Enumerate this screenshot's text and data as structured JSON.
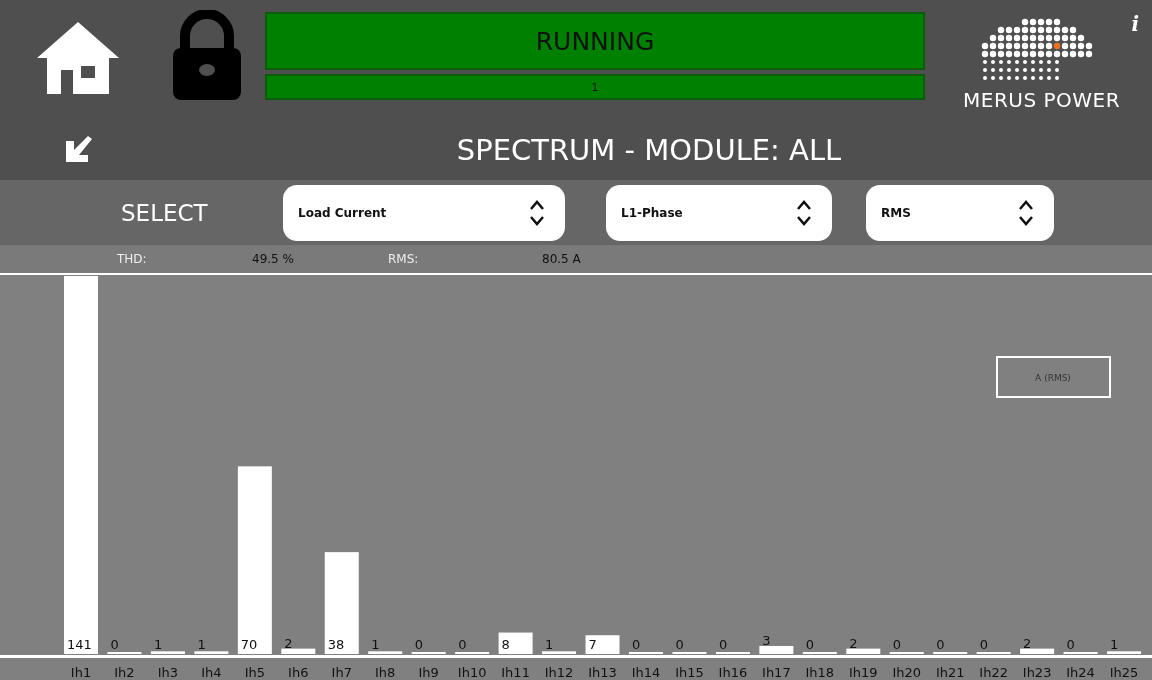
{
  "header": {
    "status": {
      "label": "RUNNING",
      "detail": "1"
    },
    "brand": "MERUS POWER",
    "info": "i"
  },
  "title": "SPECTRUM - MODULE: ALL",
  "select": {
    "label": "SELECT",
    "dropdowns": [
      {
        "value": "Load Current"
      },
      {
        "value": "L1-Phase"
      },
      {
        "value": "RMS"
      }
    ]
  },
  "readings": [
    {
      "label": "THD:",
      "value": "49.5 %"
    },
    {
      "label": "RMS:",
      "value": "80.5 A"
    }
  ],
  "chart": {
    "chart_data": {
      "type": "bar",
      "categories": [
        "Ih1",
        "Ih2",
        "Ih3",
        "Ih4",
        "Ih5",
        "Ih6",
        "Ih7",
        "Ih8",
        "Ih9",
        "Ih10",
        "Ih11",
        "Ih12",
        "Ih13",
        "Ih14",
        "Ih15",
        "Ih16",
        "Ih17",
        "Ih18",
        "Ih19",
        "Ih20",
        "Ih21",
        "Ih22",
        "Ih23",
        "Ih24",
        "Ih25"
      ],
      "series": [
        {
          "name": "A (RMS)",
          "color": "#ffffff",
          "values": [
            141,
            0,
            1,
            1,
            70,
            2,
            38,
            1,
            0,
            0,
            8,
            1,
            7,
            0,
            0,
            0,
            3,
            0,
            2,
            0,
            0,
            0,
            2,
            0,
            1
          ]
        }
      ],
      "data_labels": true
    }
  }
}
